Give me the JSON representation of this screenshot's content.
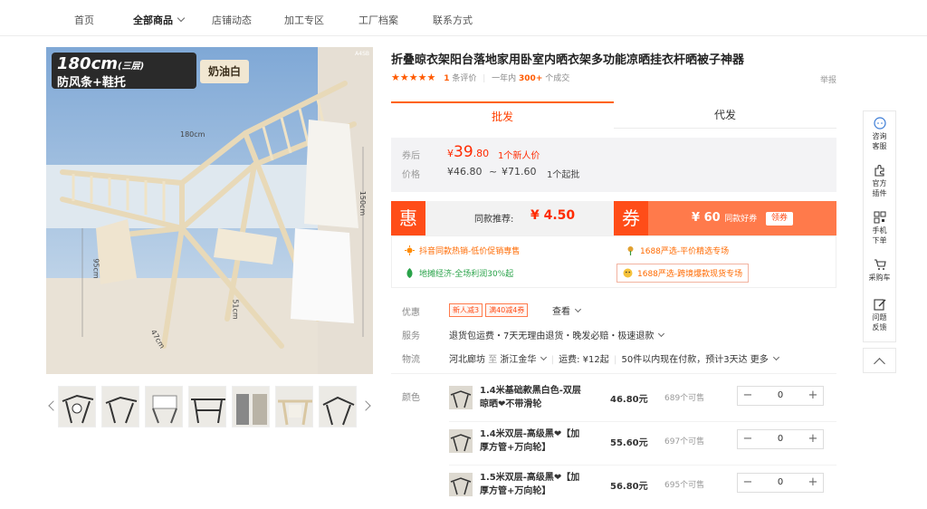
{
  "nav": {
    "items": [
      "首页",
      "全部商品",
      "店铺动态",
      "加工专区",
      "工厂档案",
      "联系方式"
    ],
    "active_index": 1
  },
  "main_image": {
    "badge_size": "180cm",
    "badge_layers": "(三层)",
    "badge_features": "防风条+鞋托",
    "badge_color": "奶油白",
    "code": "A4SB",
    "dim_width": "180cm",
    "dim_height": "150cm",
    "dim_side": "51cm",
    "dim_mid": "95cm",
    "dim_depth": "47cm"
  },
  "product": {
    "title": "折叠晾衣架阳台落地家用卧室内晒衣架多功能凉晒挂衣杆晒被子神器",
    "stars": "★★★★★",
    "review_count": "1",
    "review_label": "条评价",
    "sales_prefix": "一年内",
    "sales_count": "300+",
    "sales_suffix": "个成交",
    "report": "举报"
  },
  "tabs": [
    "批发",
    "代发"
  ],
  "price": {
    "coupon_label": "券后",
    "coupon_currency": "¥",
    "coupon_int": "39",
    "coupon_dec": ".80",
    "coupon_note": "1个新人价",
    "price_label": "价格",
    "range_low": "¥46.80",
    "range_sep": "~",
    "range_high": "¥71.60",
    "range_note": "1个起批"
  },
  "promo": {
    "hui_char": "惠",
    "same_label": "同款推荐:",
    "same_amount": "¥ 4.50",
    "quan_char": "券",
    "coupon_amount": "¥ 60",
    "coupon_note": "同款好券",
    "coupon_button": "领券"
  },
  "links": [
    {
      "text": "抖音同款热销-低价促销専售",
      "color": "orange"
    },
    {
      "text": "1688严选-平价精选专场",
      "color": "orange"
    },
    {
      "text": "地摊经济-全场利润30%起",
      "color": "green"
    },
    {
      "text": "1688严选-跨境爆款现货专场",
      "color": "orange"
    }
  ],
  "info": {
    "offer_label": "优惠",
    "offer_tags": [
      "新人减3",
      "满40减4券"
    ],
    "offer_more": "查看",
    "service_label": "服务",
    "service_text": "退货包运费・7天无理由退货・晚发必赔・极速退款",
    "ship_label": "物流",
    "ship_from": "河北廊坊",
    "ship_to_word": "至",
    "ship_to": "浙江金华",
    "ship_fee": "运费: ¥12起",
    "ship_note": "50件以内现在付款，预计3天达",
    "ship_more": "更多",
    "color_label": "颜色"
  },
  "skus": [
    {
      "name": "1.4米基础款黑白色-双层晾晒❤不带滑轮",
      "price": "46.80元",
      "stock": "689个可售",
      "qty": "0",
      "minus": "−",
      "plus": "+"
    },
    {
      "name": "1.4米双层-高级黑❤【加厚方管+万向轮】",
      "price": "55.60元",
      "stock": "697个可售",
      "qty": "0",
      "minus": "−",
      "plus": "+"
    },
    {
      "name": "1.5米双层-高级黑❤【加厚方管+万向轮】",
      "price": "56.80元",
      "stock": "695个可售",
      "qty": "0",
      "minus": "−",
      "plus": "+"
    }
  ],
  "sidebar": [
    {
      "label1": "咨询",
      "label2": "客服",
      "icon": "chat-icon"
    },
    {
      "label1": "官方",
      "label2": "插件",
      "icon": "puzzle-icon"
    },
    {
      "label1": "手机",
      "label2": "下单",
      "icon": "qrcode-icon"
    },
    {
      "label1": "采购车",
      "label2": "",
      "icon": "cart-icon"
    },
    {
      "label1": "问题",
      "label2": "反馈",
      "icon": "edit-icon"
    }
  ],
  "colors": {
    "accent": "#ff4d18",
    "price_red": "#ff2a00",
    "coupon_orange": "#ff7a4b",
    "green": "#2aa34a"
  }
}
